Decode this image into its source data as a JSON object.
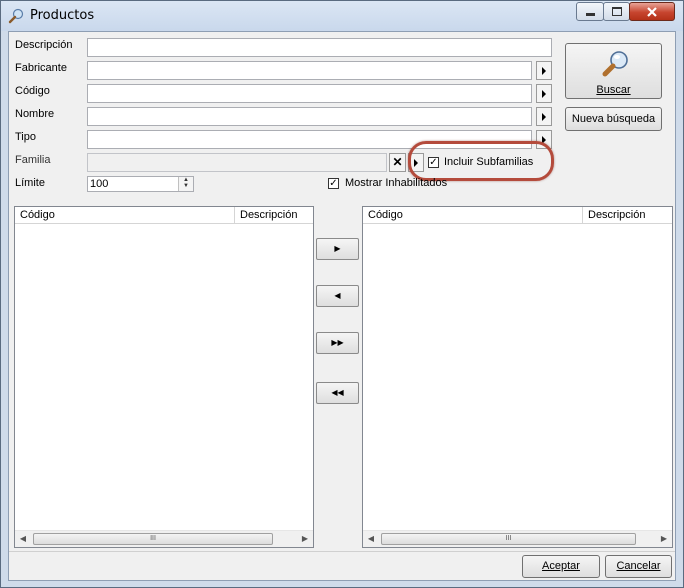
{
  "window": {
    "title": "Productos",
    "controls": {
      "minimize": "minimize-icon",
      "maximize": "maximize-icon",
      "close": "close-icon"
    }
  },
  "form": {
    "descripcion_label": "Descripción",
    "fabricante_label": "Fabricante",
    "codigo_label": "Código",
    "nombre_label": "Nombre",
    "tipo_label": "Tipo",
    "familia_label": "Familia",
    "limite_label": "Límite",
    "limite_value": "100",
    "incluir_subfamilias_label": "Incluir Subfamilias",
    "incluir_subfamilias_checked": true,
    "mostrar_inhabilitados_label": "Mostrar Inhabilitados",
    "mostrar_inhabilitados_checked": true
  },
  "buttons": {
    "buscar": "Buscar",
    "nueva_busqueda": "Nueva búsqueda",
    "aceptar": "Aceptar",
    "cancelar": "Cancelar"
  },
  "left_list": {
    "columns": [
      "Código",
      "Descripción"
    ]
  },
  "right_list": {
    "columns": [
      "Código",
      "Descripción"
    ]
  },
  "move_buttons": [
    "move-right-icon",
    "move-left-icon",
    "move-all-right-icon",
    "move-all-left-icon"
  ],
  "colors": {
    "highlight": "#b44b3c",
    "titlebar": "#cfdbea"
  }
}
